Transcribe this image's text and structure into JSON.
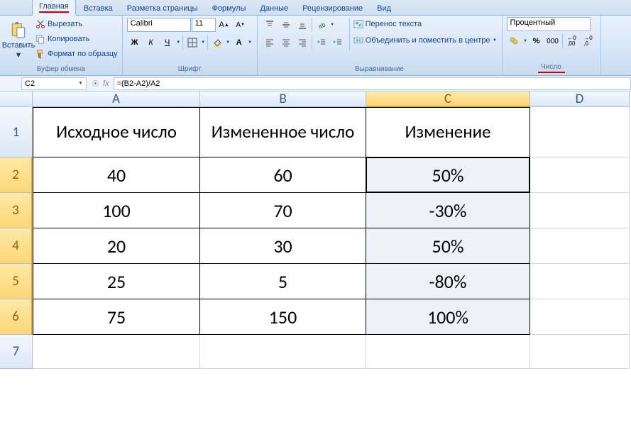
{
  "tabs": [
    "Главная",
    "Вставка",
    "Разметка страницы",
    "Формулы",
    "Данные",
    "Рецензирование",
    "Вид"
  ],
  "active_tab": 0,
  "ribbon": {
    "clipboard": {
      "paste": "Вставить",
      "cut": "Вырезать",
      "copy": "Копировать",
      "format_painter": "Формат по образцу",
      "title": "Буфер обмена"
    },
    "font": {
      "name": "Calibri",
      "size": "11",
      "bold": "Ж",
      "italic": "К",
      "underline": "Ч",
      "title": "Шрифт"
    },
    "alignment": {
      "wrap": "Перенос текста",
      "merge": "Объединить и поместить в центре",
      "title": "Выравнивание"
    },
    "number": {
      "format": "Процентный",
      "title": "Число"
    }
  },
  "namebox": "C2",
  "formula": "=(B2-A2)/A2",
  "columns": [
    "A",
    "B",
    "C",
    "D"
  ],
  "col_headers": [
    "Исходное число",
    "Измененное число",
    "Изменение"
  ],
  "rows": [
    {
      "n": "2",
      "a": "40",
      "b": "60",
      "c": "50%"
    },
    {
      "n": "3",
      "a": "100",
      "b": "70",
      "c": "-30%"
    },
    {
      "n": "4",
      "a": "20",
      "b": "30",
      "c": "50%"
    },
    {
      "n": "5",
      "a": "25",
      "b": "5",
      "c": "-80%"
    },
    {
      "n": "6",
      "a": "75",
      "b": "150",
      "c": "100%"
    }
  ],
  "selected_column": "C",
  "selected_rows": [
    "2",
    "3",
    "4",
    "5",
    "6"
  ]
}
